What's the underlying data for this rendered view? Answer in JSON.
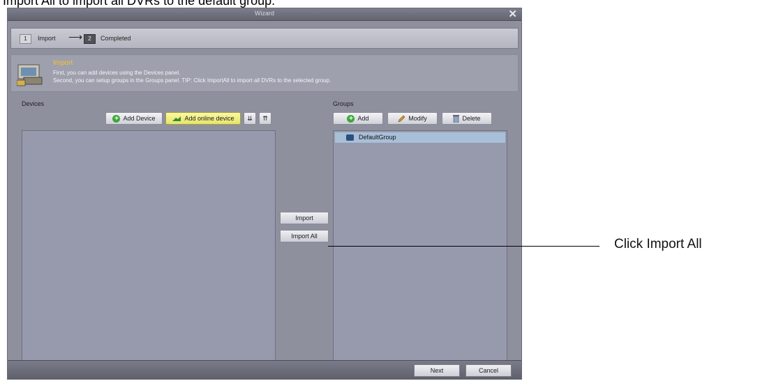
{
  "document": {
    "caption": "Import All to import all DVRs to the default group.",
    "callout": "Click Import All"
  },
  "window": {
    "title": "Wizard",
    "close_glyph": "✕"
  },
  "steps": {
    "step1_num": "1",
    "step1_label": "Import",
    "arrow": "⟶",
    "step2_num": "2",
    "step2_label": "Completed"
  },
  "info": {
    "title": "Import",
    "line1": "First, you can add devices using the Devices panel.",
    "line2": "Second, you can setup groups in the Groups panel. TIP: Click ImportAll to import all DVRs to the selected group.",
    "icon": "import-wizard-icon"
  },
  "devices": {
    "label": "Devices",
    "add_device": "Add Device",
    "add_online_device": "Add online device",
    "expand_glyph": "⇊",
    "collapse_glyph": "⇈"
  },
  "groups": {
    "label": "Groups",
    "add": "Add",
    "modify": "Modify",
    "delete": "Delete",
    "items": [
      "DefaultGroup"
    ]
  },
  "middle": {
    "import": "Import",
    "import_all": "Import All"
  },
  "footer": {
    "next": "Next",
    "cancel": "Cancel"
  },
  "colors": {
    "info_title": "#f2c230",
    "highlight_button": "#fbf9a0",
    "selected_row": "#a8bfd8"
  }
}
